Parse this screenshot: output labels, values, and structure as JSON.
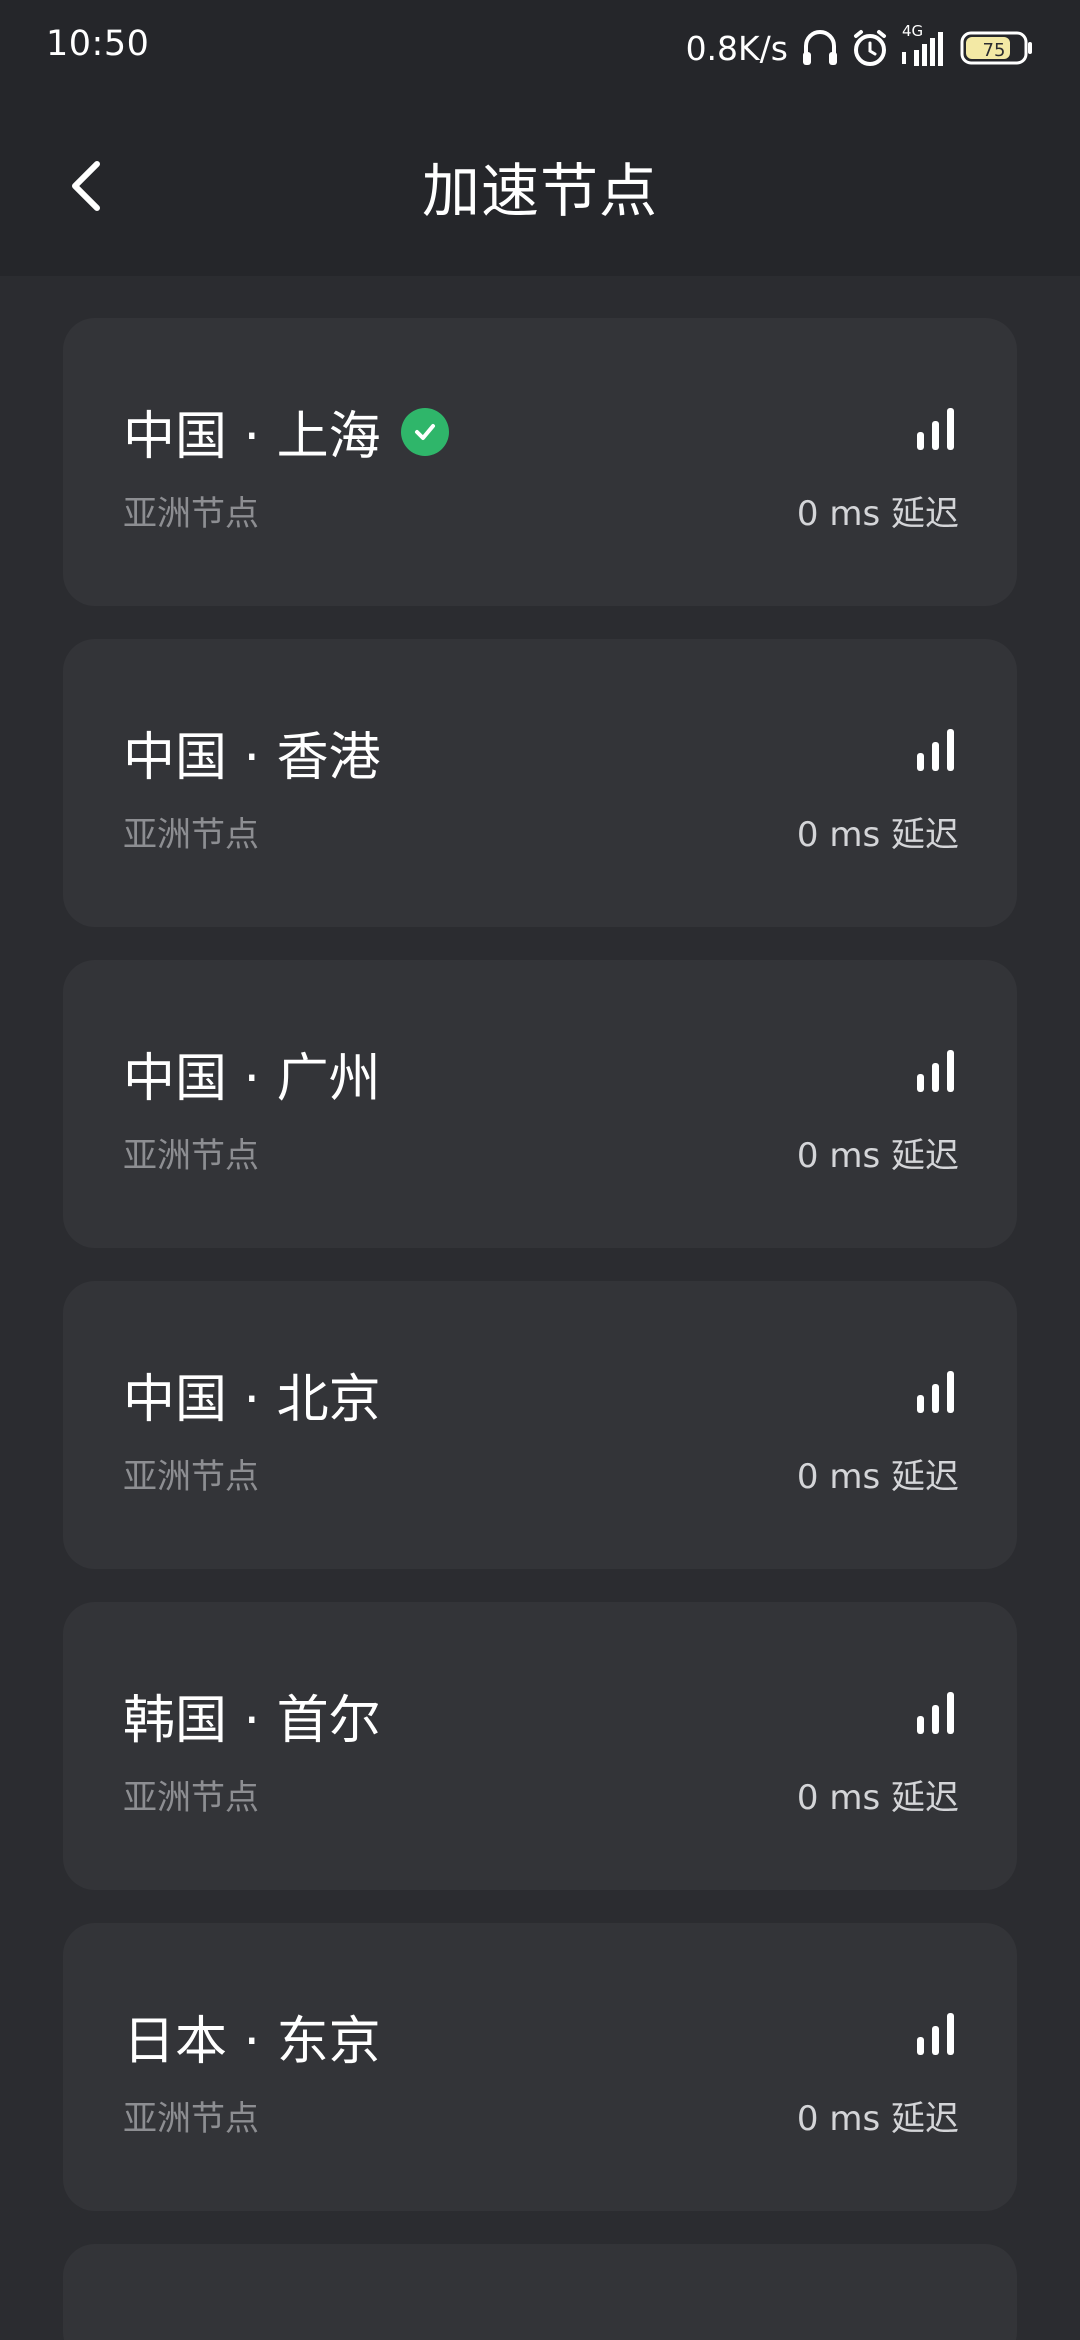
{
  "status_bar": {
    "time": "10:50",
    "net_speed": "0.8K/s",
    "network_type": "4G",
    "battery_level": "75",
    "icons": [
      "headset-icon",
      "alarm-icon",
      "signal-icon",
      "battery-icon"
    ]
  },
  "header": {
    "title": "加速节点",
    "back_icon": "chevron-left-icon"
  },
  "colors": {
    "background": "#25262a",
    "content_background": "#2b2c30",
    "card": "#333438",
    "selected_check": "#2fb66a",
    "secondary_text": "#8d8e92"
  },
  "nodes": [
    {
      "name": "中国 · 上海",
      "region": "亚洲节点",
      "latency": "0 ms 延迟",
      "selected": true
    },
    {
      "name": "中国 · 香港",
      "region": "亚洲节点",
      "latency": "0 ms 延迟",
      "selected": false
    },
    {
      "name": "中国 · 广州",
      "region": "亚洲节点",
      "latency": "0 ms 延迟",
      "selected": false
    },
    {
      "name": "中国 · 北京",
      "region": "亚洲节点",
      "latency": "0 ms 延迟",
      "selected": false
    },
    {
      "name": "韩国 · 首尔",
      "region": "亚洲节点",
      "latency": "0 ms 延迟",
      "selected": false
    },
    {
      "name": "日本 · 东京",
      "region": "亚洲节点",
      "latency": "0 ms 延迟",
      "selected": false
    }
  ]
}
